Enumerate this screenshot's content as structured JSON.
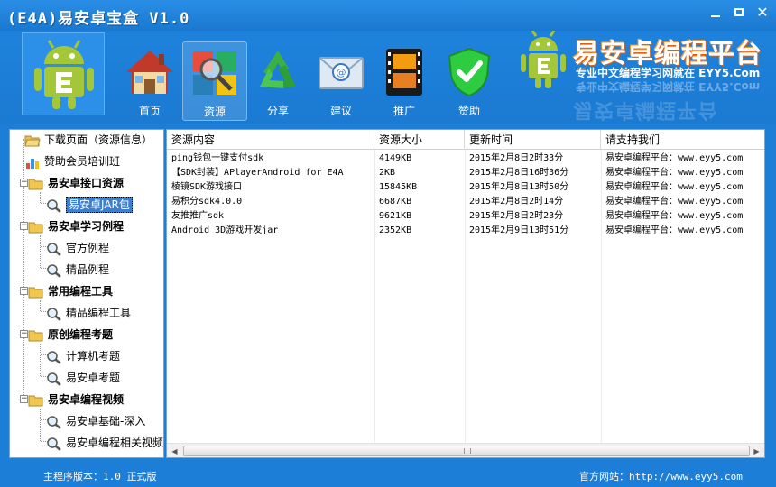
{
  "window": {
    "title": "(E4A)易安卓宝盒 V1.0"
  },
  "nav": [
    {
      "label": "首页",
      "icon": "house-icon"
    },
    {
      "label": "资源",
      "icon": "resource-search-icon"
    },
    {
      "label": "分享",
      "icon": "recycle-share-icon"
    },
    {
      "label": "建议",
      "icon": "mail-suggest-icon"
    },
    {
      "label": "推广",
      "icon": "film-promote-icon"
    },
    {
      "label": "赞助",
      "icon": "shield-check-icon"
    }
  ],
  "brand": {
    "title": "易安卓编程平台",
    "subtitle": "专业中文编程学习网就在 EYY5.Com"
  },
  "tree": [
    {
      "label": "下载页面（资源信息）",
      "type": "folder-open",
      "level": 0
    },
    {
      "label": "赞助会员培训班",
      "type": "chart",
      "level": 0
    },
    {
      "label": "易安卓接口资源",
      "type": "folder",
      "level": 0,
      "bold": true,
      "expander": "-"
    },
    {
      "label": "易安卓JAR包",
      "type": "search",
      "level": 1,
      "selected": true
    },
    {
      "label": "易安卓学习例程",
      "type": "folder",
      "level": 0,
      "bold": true,
      "expander": "-"
    },
    {
      "label": "官方例程",
      "type": "search",
      "level": 1
    },
    {
      "label": "精品例程",
      "type": "search",
      "level": 1
    },
    {
      "label": "常用编程工具",
      "type": "folder",
      "level": 0,
      "bold": true,
      "expander": "-"
    },
    {
      "label": "精品编程工具",
      "type": "search",
      "level": 1
    },
    {
      "label": "原创编程考题",
      "type": "folder",
      "level": 0,
      "bold": true,
      "expander": "-"
    },
    {
      "label": "计算机考题",
      "type": "search",
      "level": 1
    },
    {
      "label": "易安卓考题",
      "type": "search",
      "level": 1
    },
    {
      "label": "易安卓编程视频",
      "type": "folder",
      "level": 0,
      "bold": true,
      "expander": "-"
    },
    {
      "label": "易安卓基础-深入",
      "type": "search",
      "level": 1
    },
    {
      "label": "易安卓编程相关视频",
      "type": "search",
      "level": 1
    }
  ],
  "table": {
    "columns": [
      "资源内容",
      "资源大小",
      "更新时间",
      "请支持我们"
    ],
    "rows": [
      [
        "ping钱包一键支付sdk",
        "4149KB",
        "2015年2月8日2时33分",
        "易安卓编程平台：www.eyy5.com"
      ],
      [
        "【SDK封装】APlayerAndroid for E4A",
        "2KB",
        "2015年2月8日16时36分",
        "易安卓编程平台：www.eyy5.com"
      ],
      [
        "棱镜SDK游戏接口",
        "15845KB",
        "2015年2月8日13时50分",
        "易安卓编程平台：www.eyy5.com"
      ],
      [
        "易积分sdk4.0.0",
        "6687KB",
        "2015年2月8日2时14分",
        "易安卓编程平台：www.eyy5.com"
      ],
      [
        "友推推广sdk",
        "9621KB",
        "2015年2月8日2时23分",
        "易安卓编程平台：www.eyy5.com"
      ],
      [
        "Android 3D游戏开发jar",
        "2352KB",
        "2015年2月9日13时51分",
        "易安卓编程平台：www.eyy5.com"
      ]
    ]
  },
  "status": {
    "version": "主程序版本：1.0 正式版",
    "website": "官方网站：http://www.eyy5.com"
  },
  "colors": {
    "background": "#1c7ed6",
    "selected": "#3b7fd0",
    "brand_accent": "#e06010"
  }
}
